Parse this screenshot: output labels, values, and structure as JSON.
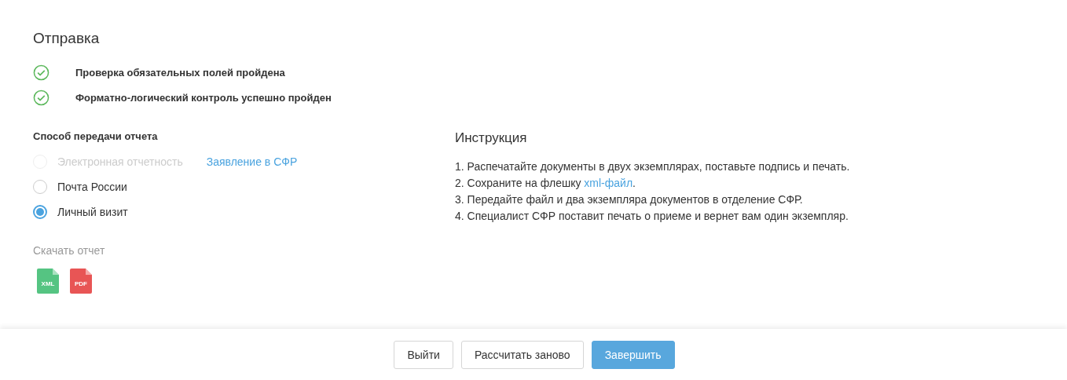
{
  "title": "Отправка",
  "checks": [
    {
      "text": "Проверка обязательных полей пройдена",
      "passed": true
    },
    {
      "text": "Форматно-логический контроль успешно пройден",
      "passed": true
    }
  ],
  "delivery": {
    "heading": "Способ передачи отчета",
    "options": [
      {
        "label": "Электронная отчетность",
        "disabled": true,
        "selected": false,
        "link": "Заявление в СФР"
      },
      {
        "label": "Почта России",
        "disabled": false,
        "selected": false
      },
      {
        "label": "Личный визит",
        "disabled": false,
        "selected": true
      }
    ]
  },
  "download": {
    "heading": "Скачать отчет",
    "files": [
      {
        "kind": "xml",
        "label": "XML"
      },
      {
        "kind": "pdf",
        "label": "PDF"
      }
    ]
  },
  "instruction": {
    "heading": "Инструкция",
    "steps": [
      {
        "text": "1. Распечатайте документы в двух экземплярах, поставьте подпись и печать."
      },
      {
        "text": "2. Сохраните на флешку ",
        "link": "xml-файл",
        "after": "."
      },
      {
        "text": "3. Передайте файл и два экземпляра документов в отделение СФР."
      },
      {
        "text": "4. Специалист СФР поставит печать о приеме и вернет вам один экземпляр."
      }
    ]
  },
  "buttons": [
    {
      "label": "Выйти",
      "kind": "default"
    },
    {
      "label": "Рассчитать заново",
      "kind": "default"
    },
    {
      "label": "Завершить",
      "kind": "primary"
    }
  ]
}
